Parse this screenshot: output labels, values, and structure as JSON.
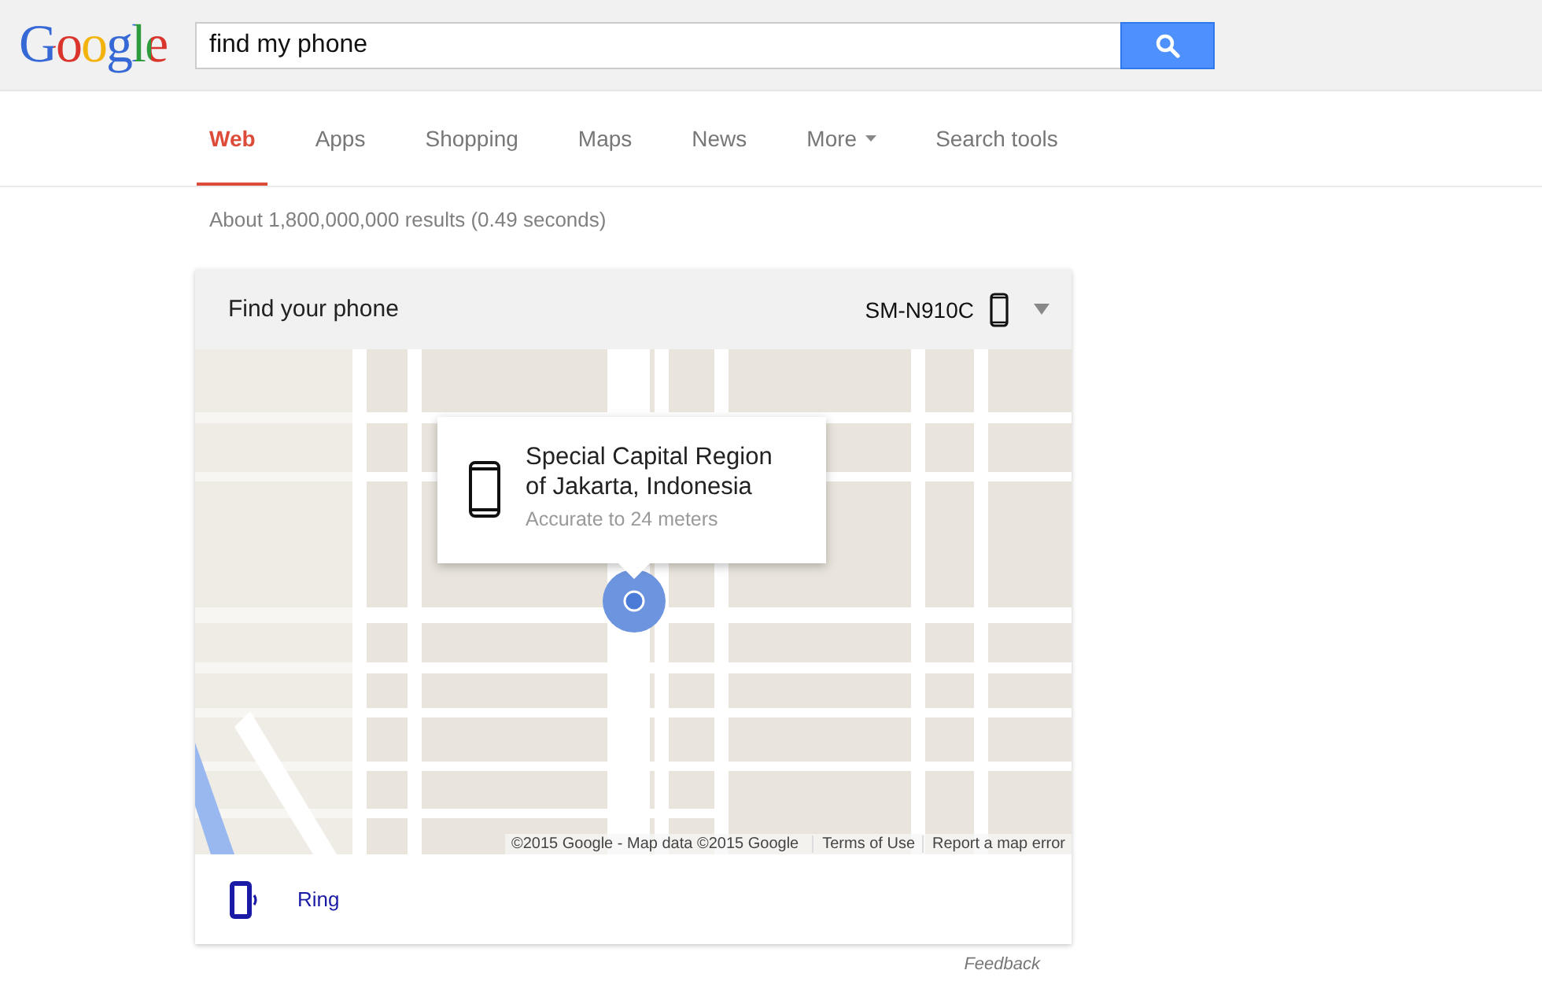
{
  "header": {
    "logo": "Google",
    "search": {
      "value": "find my phone"
    }
  },
  "tabs": [
    {
      "label": "Web",
      "selected": true,
      "kind": "link"
    },
    {
      "label": "Apps",
      "selected": false,
      "kind": "link"
    },
    {
      "label": "Shopping",
      "selected": false,
      "kind": "link"
    },
    {
      "label": "Maps",
      "selected": false,
      "kind": "link"
    },
    {
      "label": "News",
      "selected": false,
      "kind": "link"
    },
    {
      "label": "More",
      "selected": false,
      "kind": "menu"
    },
    {
      "label": "Search tools",
      "selected": false,
      "kind": "link"
    }
  ],
  "result_stats": "About 1,800,000,000 results (0.49 seconds)",
  "card": {
    "title": "Find your phone",
    "device": "SM-N910C",
    "popup": {
      "title": "Special Capital Region of Jakarta, Indonesia",
      "accuracy": "Accurate to 24 meters"
    },
    "attribution": "©2015 Google - Map data ©2015 Google",
    "map_links": [
      "Terms of Use",
      "Report a map error"
    ],
    "action": "Ring"
  },
  "feedback": "Feedback"
}
